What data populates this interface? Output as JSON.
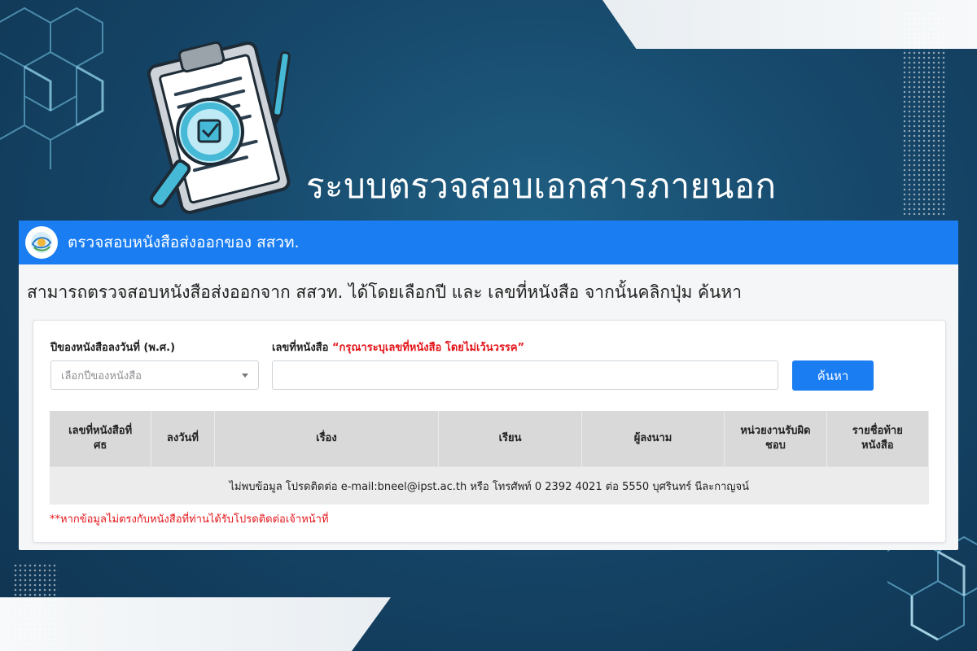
{
  "page": {
    "title": "ระบบตรวจสอบเอกสารภายนอก"
  },
  "card": {
    "header_title": "ตรวจสอบหนังสือส่งออกของ สสวท.",
    "instruction": "สามารถตรวจสอบหนังสือส่งออกจาก สสวท. ได้โดยเลือกปี และ เลขที่หนังสือ จากนั้นคลิกปุ่ม ค้นหา"
  },
  "form": {
    "year_label": "ปีของหนังสือลงวันที่ (พ.ศ.)",
    "year_placeholder": "เลือกปีของหนังสือ",
    "docno_label": "เลขที่หนังสือ",
    "docno_warning": "“กรุณาระบุเลขที่หนังสือ โดยไม่เว้นวรรค”",
    "docno_value": "",
    "search_label": "ค้นหา"
  },
  "table": {
    "headers": {
      "docno_1": "เลขที่หนังสือที่",
      "docno_2": "ศธ",
      "date": "ลงวันที่",
      "subject": "เรื่อง",
      "to": "เรียน",
      "signer": "ผู้ลงนาม",
      "unit_1": "หน่วยงานรับผิด",
      "unit_2": "ชอบ",
      "footer_1": "รายชื่อท้าย",
      "footer_2": "หนังสือ"
    },
    "empty_message": "ไม่พบข้อมูล โปรดติดต่อ e-mail:bneel@ipst.ac.th หรือ โทรศัพท์ 0 2392 4021 ต่อ 5550 บุศรินทร์ นีละกาญจน์"
  },
  "note": "**หากข้อมูลไม่ตรงกับหนังสือที่ท่านได้รับโปรดติดต่อเจ้าหน้าที่",
  "colors": {
    "primary": "#1a7ef2",
    "warning": "#e3161b",
    "background": "#16476a"
  },
  "icons": {
    "hero": "clipboard-magnifier-icon",
    "logo": "ipst-logo-icon",
    "caret": "chevron-down-icon"
  }
}
